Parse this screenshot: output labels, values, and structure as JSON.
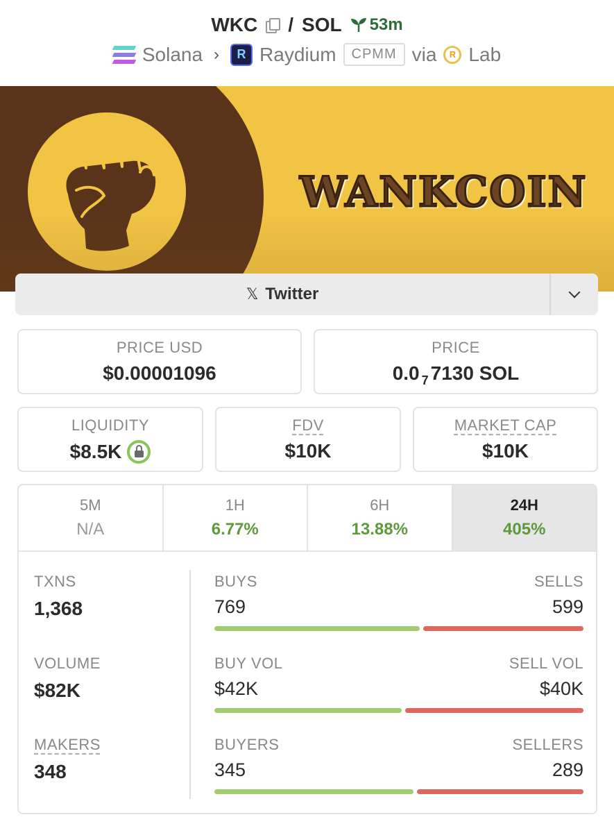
{
  "header": {
    "base_symbol": "WKC",
    "separator": "/",
    "quote_symbol": "SOL",
    "age": "53m",
    "chain": "Solana",
    "dex": "Raydium",
    "pool_type": "CPMM",
    "via": "via",
    "launchpad": "Lab"
  },
  "banner": {
    "wordmark": "WANKCOIN"
  },
  "social": {
    "twitter_label": "Twitter"
  },
  "price_usd": {
    "label": "PRICE USD",
    "value": "$0.00001096"
  },
  "price_native": {
    "label": "PRICE",
    "prefix": "0.0",
    "zeros": "7",
    "suffix": "7130 SOL"
  },
  "liquidity": {
    "label": "LIQUIDITY",
    "value": "$8.5K"
  },
  "fdv": {
    "label": "FDV",
    "value": "$10K"
  },
  "market_cap": {
    "label": "MARKET CAP",
    "value": "$10K"
  },
  "timeframes": [
    {
      "label": "5M",
      "value": "N/A"
    },
    {
      "label": "1H",
      "value": "6.77%"
    },
    {
      "label": "6H",
      "value": "13.88%"
    },
    {
      "label": "24H",
      "value": "405%"
    }
  ],
  "stats": {
    "txns": {
      "label": "TXNS",
      "value": "1,368"
    },
    "volume": {
      "label": "VOLUME",
      "value": "$82K"
    },
    "makers": {
      "label": "MAKERS",
      "value": "348"
    }
  },
  "splits": {
    "txns": {
      "left_label": "BUYS",
      "right_label": "SELLS",
      "left_value": "769",
      "right_value": "599",
      "buy_share": 0.562
    },
    "volume": {
      "left_label": "BUY VOL",
      "right_label": "SELL VOL",
      "left_value": "$42K",
      "right_value": "$40K",
      "buy_share": 0.512
    },
    "makers": {
      "left_label": "BUYERS",
      "right_label": "SELLERS",
      "left_value": "345",
      "right_value": "289",
      "buy_share": 0.544
    }
  },
  "colors": {
    "buy": "#a3cc6e",
    "sell": "#e06760",
    "positive": "#5d9a3a",
    "banner_yellow": "#f1c444",
    "banner_brown": "#5a341a"
  }
}
